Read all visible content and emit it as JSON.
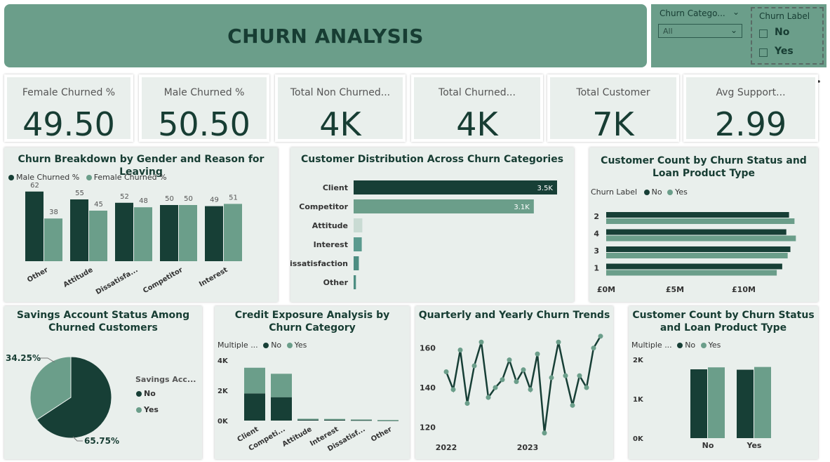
{
  "title": "CHURN ANALYSIS",
  "colors": {
    "dark": "#173f36",
    "light": "#6b9e8a",
    "bg": "#e9efec",
    "banner": "#6b9e8a"
  },
  "slicers": {
    "category_label": "Churn Catego...",
    "category_value": "All",
    "churn_label_title": "Churn Label",
    "options": [
      "No",
      "Yes"
    ]
  },
  "toolbar": {
    "filter_icon": "filter-icon",
    "focus_icon": "focus-mode-icon",
    "more_icon": "more-options-icon"
  },
  "kpis": [
    {
      "label": "Female Churned %",
      "value": "49.50"
    },
    {
      "label": "Male Churned %",
      "value": "50.50"
    },
    {
      "label": "Total Non Churned...",
      "value": "4K"
    },
    {
      "label": "Total Churned...",
      "value": "4K"
    },
    {
      "label": "Total Customer",
      "value": "7K"
    },
    {
      "label": "Avg Support...",
      "value": "2.99"
    }
  ],
  "chart_data": [
    {
      "id": "gender_reason",
      "type": "bar",
      "title": "Churn Breakdown by Gender and Reason for Leaving",
      "legend": [
        "Male Churned %",
        "Female Churned %"
      ],
      "categories": [
        "Other",
        "Attitude",
        "Dissatisfa...",
        "Competitor",
        "Interest"
      ],
      "series": [
        {
          "name": "Male Churned %",
          "values": [
            62,
            55,
            52,
            50,
            49
          ]
        },
        {
          "name": "Female Churned %",
          "values": [
            38,
            45,
            48,
            50,
            51
          ]
        }
      ],
      "ylim": [
        0,
        75
      ]
    },
    {
      "id": "category_dist",
      "type": "bar",
      "orientation": "horizontal",
      "title": "Customer Distribution Across Churn Categories",
      "categories": [
        "Client",
        "Competitor",
        "Attitude",
        "Interest",
        "Dissatisfaction",
        "Other"
      ],
      "values": [
        3500,
        3100,
        150,
        140,
        90,
        40
      ],
      "data_labels": [
        "3.5K",
        "3.1K",
        "",
        "",
        "",
        ""
      ],
      "xlim": [
        0,
        3500
      ]
    },
    {
      "id": "loan_product",
      "type": "bar",
      "orientation": "horizontal",
      "title": "Customer Count by Churn Status and Loan Product Type",
      "legend_title": "Churn Label",
      "legend": [
        "No",
        "Yes"
      ],
      "categories": [
        "2",
        "4",
        "3",
        "1"
      ],
      "series": [
        {
          "name": "No",
          "values": [
            13.4,
            13.2,
            13.5,
            12.9
          ]
        },
        {
          "name": "Yes",
          "values": [
            13.8,
            13.9,
            13.3,
            12.5
          ]
        }
      ],
      "x_ticks": [
        "£0M",
        "£5M",
        "£10M"
      ],
      "xlim": [
        0,
        14.5
      ]
    },
    {
      "id": "savings",
      "type": "pie",
      "title": "Savings Account Status Among Churned Customers",
      "legend_title": "Savings Acc...",
      "legend": [
        "No",
        "Yes"
      ],
      "slices": [
        {
          "name": "No",
          "value": 65.75,
          "label": "65.75%"
        },
        {
          "name": "Yes",
          "value": 34.25,
          "label": "34.25%"
        }
      ]
    },
    {
      "id": "credit_exposure",
      "type": "bar",
      "stacked": true,
      "title": "Credit Exposure Analysis by Churn Category",
      "legend_title": "Multiple ...",
      "legend": [
        "No",
        "Yes"
      ],
      "categories": [
        "Client",
        "Competi...",
        "Attitude",
        "Interest",
        "Dissatisf...",
        "Other"
      ],
      "series": [
        {
          "name": "No",
          "values": [
            1800,
            1550,
            60,
            50,
            35,
            20
          ]
        },
        {
          "name": "Yes",
          "values": [
            1700,
            1550,
            60,
            60,
            35,
            20
          ]
        }
      ],
      "y_ticks": [
        "0K",
        "2K",
        "4K"
      ],
      "ylim": [
        0,
        4000
      ]
    },
    {
      "id": "quarterly_trend",
      "type": "line",
      "title": "Quarterly and Yearly Churn Trends",
      "x_ticks": [
        "2022",
        "2023"
      ],
      "y_ticks": [
        "120",
        "140",
        "160"
      ],
      "ylim": [
        113,
        167
      ],
      "values": [
        148,
        139,
        159,
        132,
        151,
        163,
        135,
        140,
        144,
        154,
        143,
        149,
        139,
        157,
        117,
        145,
        163,
        146,
        131,
        146,
        140,
        160,
        166
      ]
    },
    {
      "id": "loan_status",
      "type": "bar",
      "title": "Customer Count by Churn Status and Loan Product Type",
      "legend_title": "Multiple ...",
      "legend": [
        "No",
        "Yes"
      ],
      "categories": [
        "No",
        "Yes"
      ],
      "series": [
        {
          "name": "No",
          "values": [
            1750,
            1740
          ]
        },
        {
          "name": "Yes",
          "values": [
            1800,
            1810
          ]
        }
      ],
      "y_ticks": [
        "0K",
        "1K",
        "2K"
      ],
      "ylim": [
        0,
        2000
      ]
    }
  ]
}
